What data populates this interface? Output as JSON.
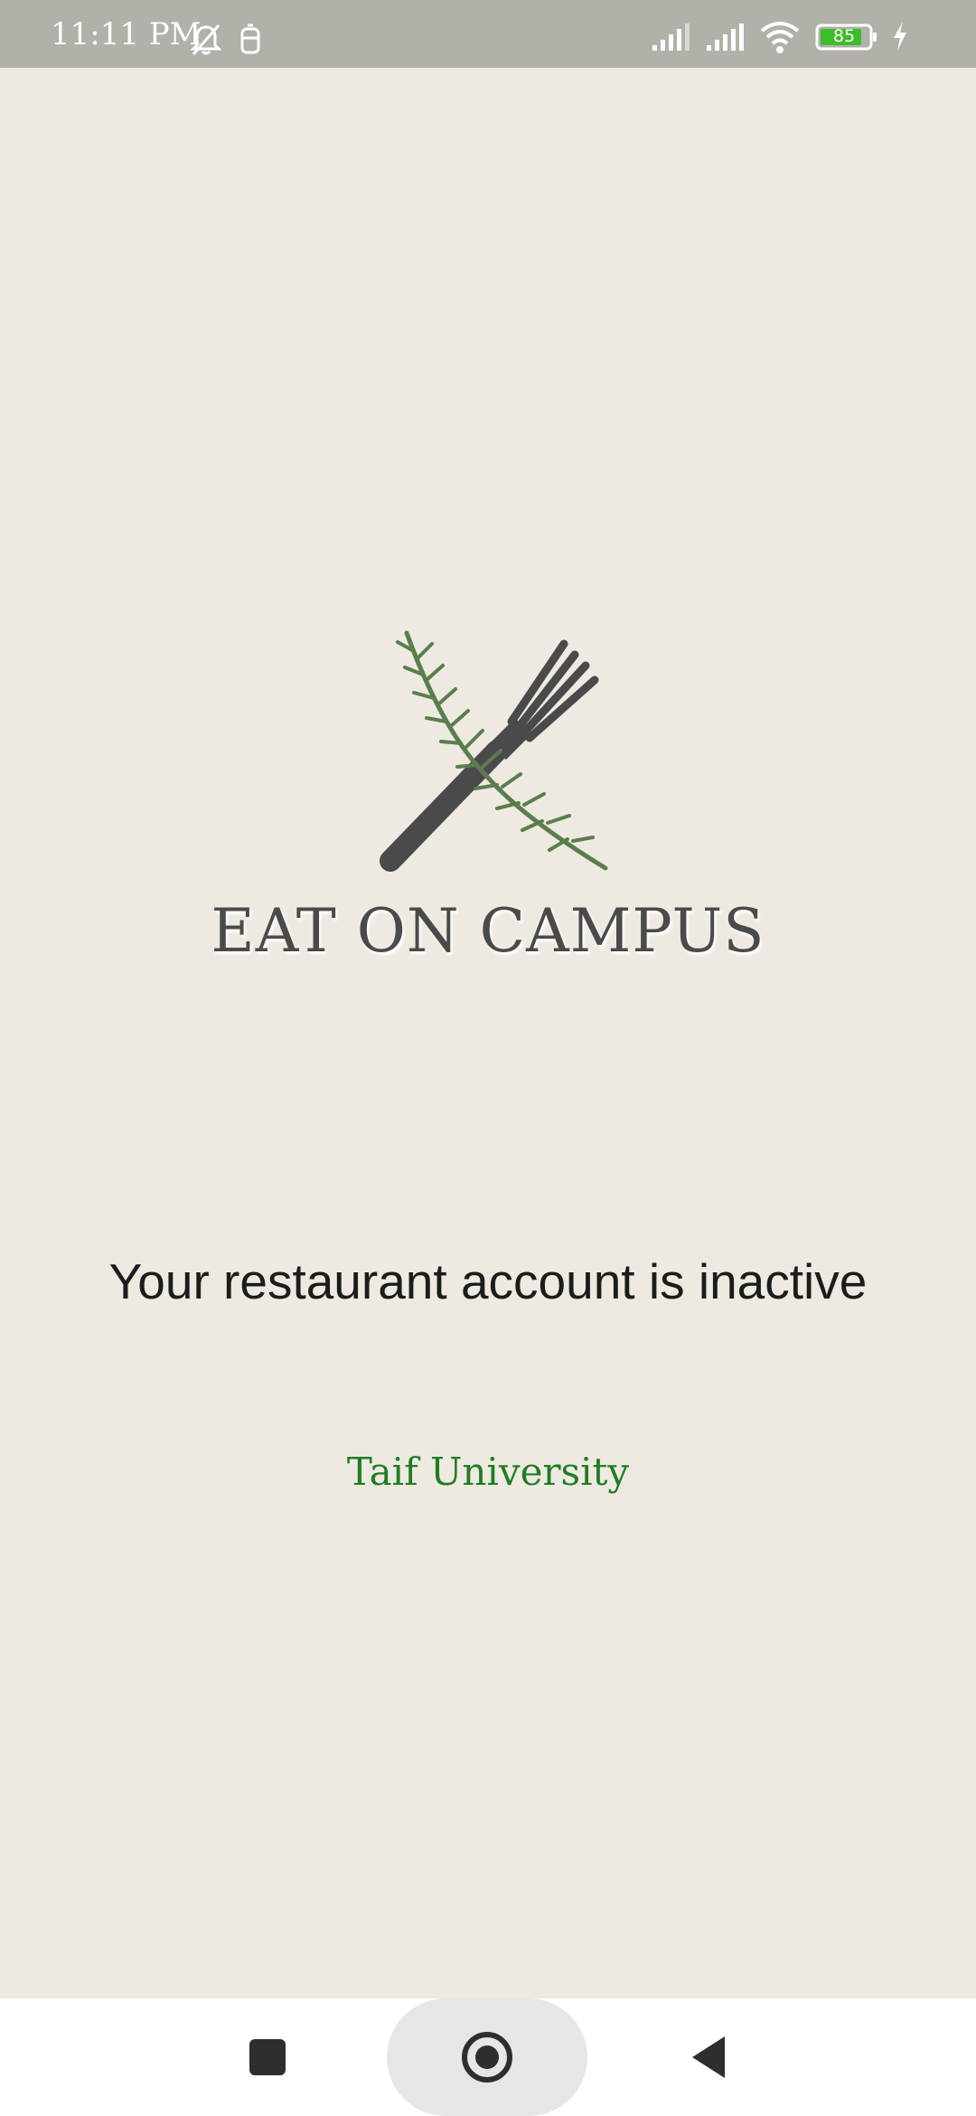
{
  "status_bar": {
    "time": "11:11 PM",
    "battery_level": "85",
    "icons": [
      "bell-off-icon",
      "cup-icon",
      "signal-icon",
      "signal-icon",
      "wifi-icon",
      "battery-icon",
      "charging-icon"
    ]
  },
  "brand": {
    "name": "EAT ON CAMPUS",
    "logo_icons": [
      "fork-icon",
      "rosemary-sprig-icon"
    ]
  },
  "message": "Your restaurant account is inactive",
  "university": "Taif University",
  "nav_bar": {
    "buttons": [
      "recents-button",
      "home-button",
      "back-button"
    ]
  },
  "colors": {
    "background": "#eeeae1",
    "status_bar": "#b3b0a9",
    "accent_green": "#1f7d23",
    "text_dark": "#1c1c1c",
    "logo_gray": "#4a4a4a",
    "sprig_green": "#5b7d4e"
  }
}
